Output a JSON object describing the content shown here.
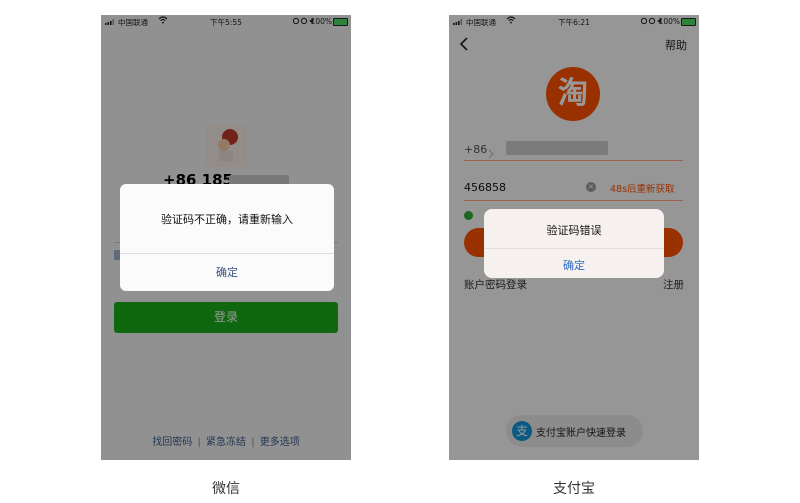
{
  "wechat": {
    "status": {
      "carrier": "中国联通",
      "time": "下午5:55",
      "battery": "100%"
    },
    "phone_number": "+86 185 ",
    "login_button": "登录",
    "footer": {
      "find_password": "找回密码",
      "sep1": "|",
      "freeze": "紧急冻结",
      "sep2": "|",
      "more": "更多选项"
    },
    "dialog": {
      "message": "验证码不正确，请重新输入",
      "ok": "确定"
    },
    "colors": {
      "login_green": "#1aad19"
    }
  },
  "taobao": {
    "status": {
      "carrier": "中国联通",
      "time": "下午6:21",
      "battery": "100%"
    },
    "help": "帮助",
    "logo_char": "淘",
    "country_code": "+86",
    "code_value": "456858",
    "resend": "48s后重新获取",
    "password_login": "账户密码登录",
    "register": "注册",
    "alipay_login": "支付宝账户快速登录",
    "alipay_char": "支",
    "dialog": {
      "message": "验证码错误",
      "ok": "确定"
    },
    "colors": {
      "brand_orange": "#ff5000"
    }
  },
  "captions": {
    "left": "微信",
    "right": "支付宝"
  }
}
